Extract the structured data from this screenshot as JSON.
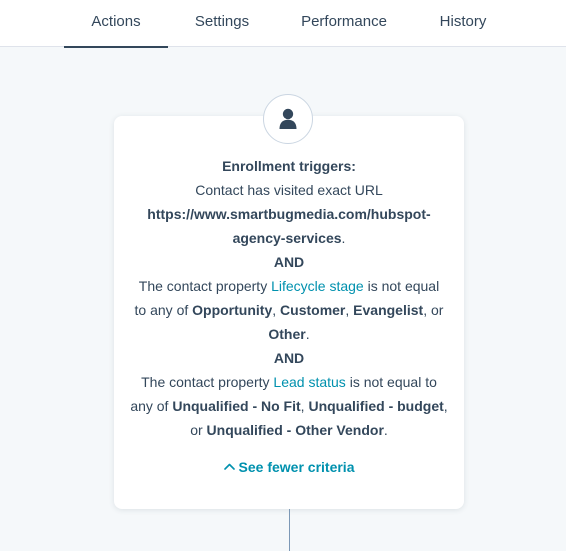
{
  "tabs": [
    {
      "label": "Actions",
      "active": true
    },
    {
      "label": "Settings",
      "active": false
    },
    {
      "label": "Performance",
      "active": false
    },
    {
      "label": "History",
      "active": false
    }
  ],
  "card": {
    "icon": "user-icon",
    "heading": "Enrollment triggers:",
    "trigger1": {
      "text": "Contact has visited exact URL",
      "url_line1": "https://www.smartbugmedia.com/hubspot-",
      "url_line2": "agency-services",
      "url_suffix": "."
    },
    "and1": "AND",
    "trigger2": {
      "prefix": "The contact property ",
      "property": "Lifecycle stage",
      "suffix": " is not equal",
      "line2_prefix": "to any of ",
      "value1": "Opportunity",
      "sep1": ", ",
      "value2": "Customer",
      "sep2": ", ",
      "value3": "Evangelist",
      "sep3": ", or",
      "value4": "Other",
      "end": "."
    },
    "and2": "AND",
    "trigger3": {
      "prefix": "The contact property ",
      "property": "Lead status",
      "suffix": " is not equal to",
      "line2_prefix": "any of ",
      "value1": "Unqualified - No Fit",
      "sep1": ", ",
      "value2": "Unqualified - budget",
      "sep2": ",",
      "line3_prefix": "or ",
      "value3": "Unqualified - Other Vendor",
      "end": "."
    },
    "toggle_label": "See fewer criteria"
  },
  "colors": {
    "link": "#0091ae",
    "text": "#33475b",
    "background": "#f5f8fa"
  }
}
